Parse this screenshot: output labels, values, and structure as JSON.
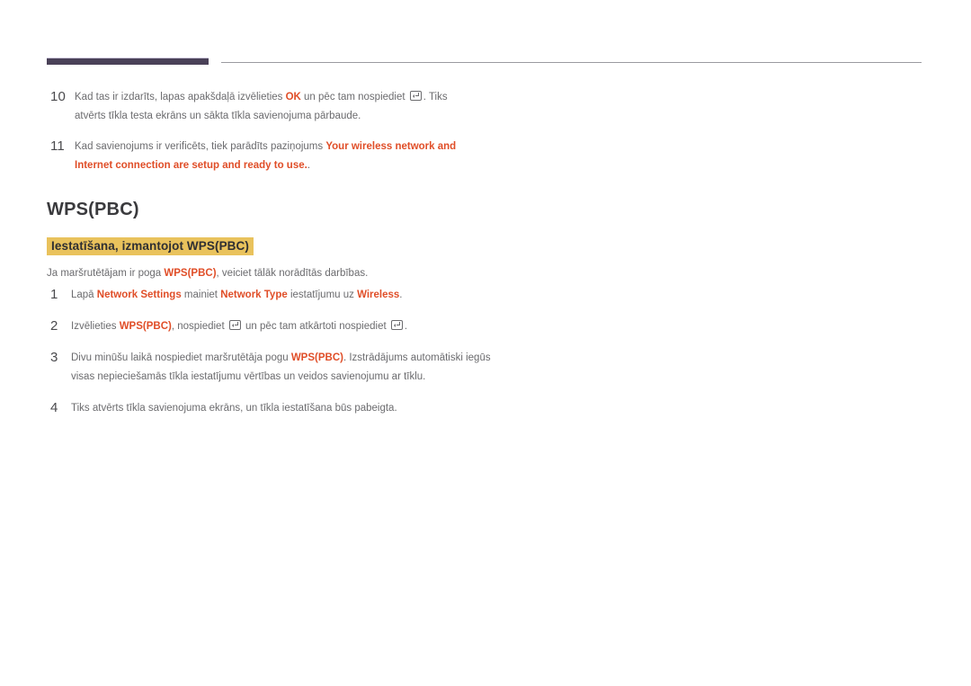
{
  "colors": {
    "accent_orange": "#e04e28",
    "highlight_gold": "#e9c25c",
    "rule_purple": "#4a4158",
    "body_text": "#6b6b6e"
  },
  "header": {
    "rule_thick": "",
    "rule_thin": ""
  },
  "top_steps": [
    {
      "number": "10",
      "parts": [
        {
          "t": "Kad tas ir izdarīts, lapas apakšdaļā izvēlieties ",
          "k": "plain"
        },
        {
          "t": "OK",
          "k": "hl"
        },
        {
          "t": " un pēc tam nospiediet ",
          "k": "plain"
        },
        {
          "t": "enter-key-icon",
          "k": "key"
        },
        {
          "t": ". Tiks atvērts tīkla testa ekrāns un sākta tīkla savienojuma pārbaude.",
          "k": "plain"
        }
      ]
    },
    {
      "number": "11",
      "parts": [
        {
          "t": "Kad savienojums ir verificēts, tiek parādīts paziņojums ",
          "k": "plain"
        },
        {
          "t": "Your wireless network and Internet connection are setup and ready to use.",
          "k": "hl"
        },
        {
          "t": ".",
          "k": "plain"
        }
      ]
    }
  ],
  "section": {
    "title": "WPS(PBC)",
    "subtitle": "Iestatīšana, izmantojot WPS(PBC)",
    "intro_parts": [
      {
        "t": "Ja maršrutētājam ir poga ",
        "k": "plain"
      },
      {
        "t": "WPS(PBC)",
        "k": "hl"
      },
      {
        "t": ", veiciet tālāk norādītās darbības.",
        "k": "plain"
      }
    ]
  },
  "bottom_steps": [
    {
      "number": "1",
      "parts": [
        {
          "t": "Lapā ",
          "k": "plain"
        },
        {
          "t": "Network Settings",
          "k": "hl"
        },
        {
          "t": " mainiet ",
          "k": "plain"
        },
        {
          "t": "Network Type",
          "k": "hl"
        },
        {
          "t": " iestatījumu uz ",
          "k": "plain"
        },
        {
          "t": "Wireless",
          "k": "hl"
        },
        {
          "t": ".",
          "k": "plain"
        }
      ]
    },
    {
      "number": "2",
      "parts": [
        {
          "t": "Izvēlieties ",
          "k": "plain"
        },
        {
          "t": "WPS(PBC)",
          "k": "hl"
        },
        {
          "t": ", nospiediet ",
          "k": "plain"
        },
        {
          "t": "enter-key-icon",
          "k": "key"
        },
        {
          "t": " un pēc tam atkārtoti nospiediet ",
          "k": "plain"
        },
        {
          "t": "enter-key-icon",
          "k": "key"
        },
        {
          "t": ".",
          "k": "plain"
        }
      ]
    },
    {
      "number": "3",
      "parts": [
        {
          "t": "Divu minūšu laikā nospiediet maršrutētāja pogu ",
          "k": "plain"
        },
        {
          "t": "WPS(PBC)",
          "k": "hl"
        },
        {
          "t": ". Izstrādājums automātiski iegūs visas nepieciešamās tīkla iestatījumu vērtības un veidos savienojumu ar tīklu.",
          "k": "plain"
        }
      ]
    },
    {
      "number": "4",
      "parts": [
        {
          "t": "Tiks atvērts tīkla savienojuma ekrāns, un tīkla iestatīšana būs pabeigta.",
          "k": "plain"
        }
      ]
    }
  ]
}
